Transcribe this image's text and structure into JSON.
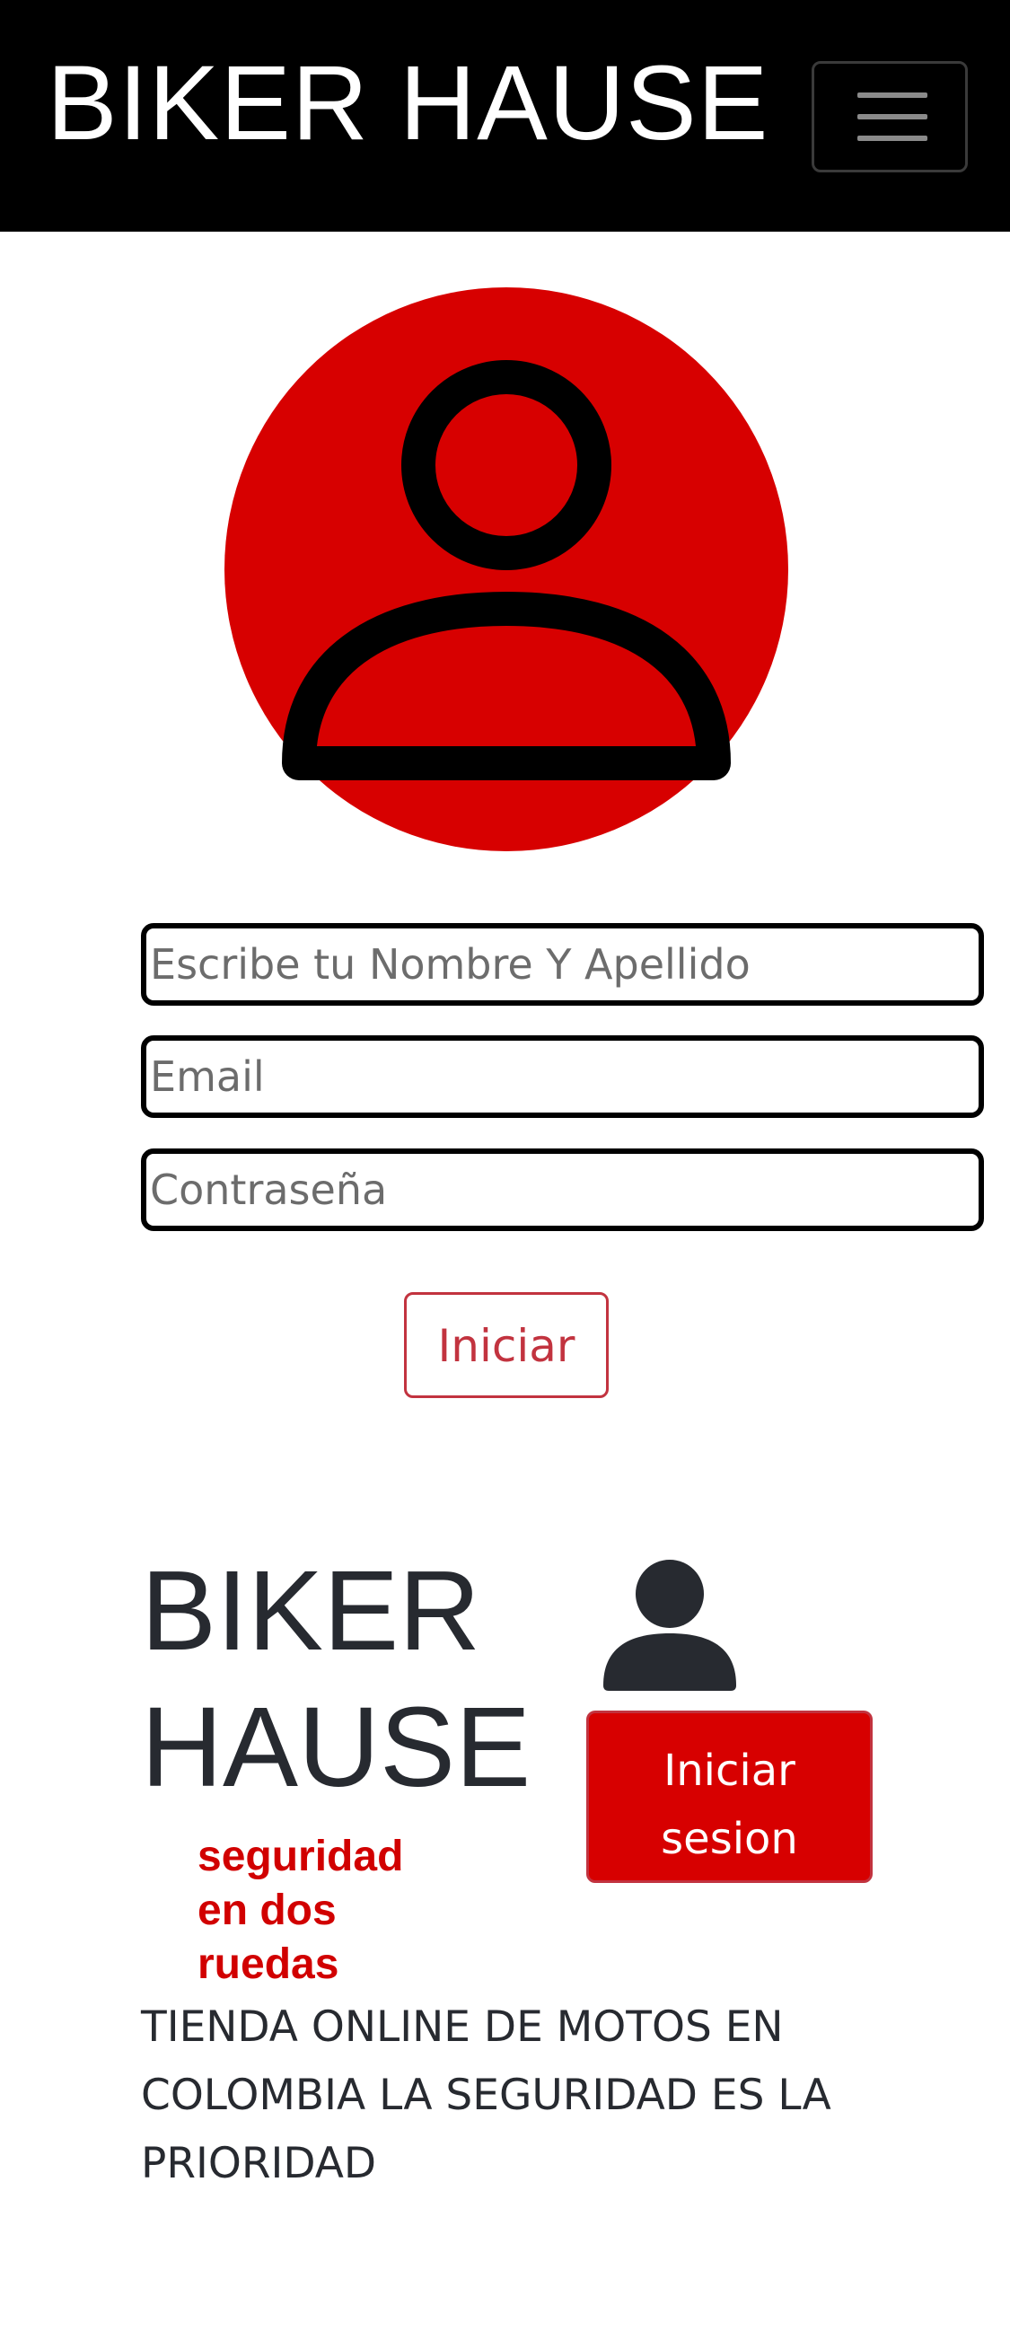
{
  "navbar": {
    "brand": "BIKER HAUSE",
    "toggler_icon": "hamburger-menu-icon"
  },
  "avatar": {
    "icon": "user-icon",
    "circle_color": "#d70000"
  },
  "form": {
    "name_placeholder": "Escribe tu Nombre Y Apellido",
    "email_placeholder": "Email",
    "password_placeholder": "Contraseña",
    "submit_label": "Iniciar"
  },
  "footer": {
    "brand_line1": "BIKER",
    "brand_line2": "HAUSE",
    "slogan": "seguridad en dos ruedas",
    "user_icon": "user-icon",
    "login_button": "Iniciar sesion",
    "tagline": "TIENDA ONLINE DE MOTOS EN COLOMBIA LA SEGURIDAD ES LA PRIORIDAD"
  },
  "colors": {
    "brand_red": "#d70000",
    "outline_red": "#c2333f",
    "navbar_bg": "#000000",
    "dark_text": "#272a30"
  }
}
